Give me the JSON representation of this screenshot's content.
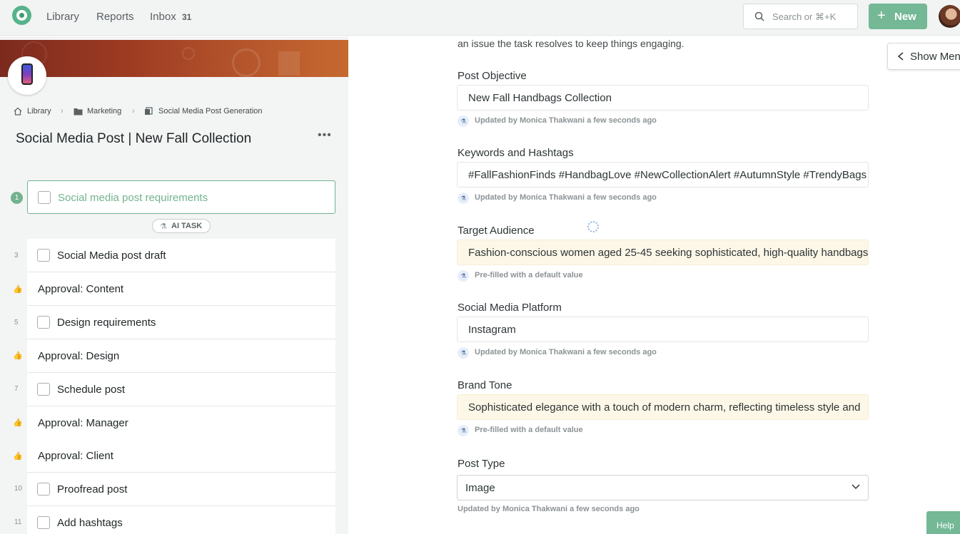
{
  "nav": {
    "library": "Library",
    "reports": "Reports",
    "inbox": "Inbox",
    "inbox_count": "31",
    "search_placeholder": "Search or ⌘+K",
    "new_label": "New"
  },
  "breadcrumb": {
    "library": "Library",
    "marketing": "Marketing",
    "template": "Social Media Post Generation"
  },
  "page_title": "Social Media Post | New Fall Collection",
  "tasks": {
    "active": {
      "num": "1",
      "label": "Social media post requirements"
    },
    "ai_badge": "AI TASK",
    "rows": [
      {
        "num": "3",
        "label": "Social Media post draft",
        "type": "task"
      },
      {
        "num": "",
        "label": "Approval: Content",
        "type": "approval"
      },
      {
        "num": "5",
        "label": "Design requirements",
        "type": "task"
      },
      {
        "num": "",
        "label": "Approval: Design",
        "type": "approval"
      },
      {
        "num": "7",
        "label": "Schedule post",
        "type": "task"
      },
      {
        "num": "",
        "label": "Approval: Manager",
        "type": "approval"
      },
      {
        "num": "",
        "label": "Approval: Client",
        "type": "approval"
      },
      {
        "num": "10",
        "label": "Proofread post",
        "type": "task"
      },
      {
        "num": "11",
        "label": "Add hashtags",
        "type": "task"
      }
    ]
  },
  "form": {
    "intro": "an issue the task resolves to keep things engaging.",
    "fields": [
      {
        "label": "Post Objective",
        "value": "New Fall Handbags Collection",
        "meta": "Updated by Monica Thakwani a few seconds ago",
        "prefilled": false
      },
      {
        "label": "Keywords and Hashtags",
        "value": "#FallFashionFinds #HandbagLove #NewCollectionAlert #AutumnStyle #TrendyBags",
        "meta": "Updated by Monica Thakwani a few seconds ago",
        "prefilled": false
      },
      {
        "label": "Target Audience",
        "value": "Fashion-conscious women aged 25-45 seeking sophisticated, high-quality handbags",
        "meta": "Pre-filled with a default value",
        "prefilled": true
      },
      {
        "label": "Social Media Platform",
        "value": "Instagram",
        "meta": "Updated by Monica Thakwani a few seconds ago",
        "prefilled": false
      },
      {
        "label": "Brand Tone",
        "value": "Sophisticated elegance with a touch of modern charm, reflecting timeless style and",
        "meta": "Pre-filled with a default value",
        "prefilled": true
      }
    ],
    "post_type": {
      "label": "Post Type",
      "value": "Image",
      "meta": "Updated by Monica Thakwani a few seconds ago"
    }
  },
  "show_menu": "Show Menu",
  "help": "Help",
  "colors": {
    "accent": "#74b896",
    "prefill_bg": "#fdf7e7"
  }
}
